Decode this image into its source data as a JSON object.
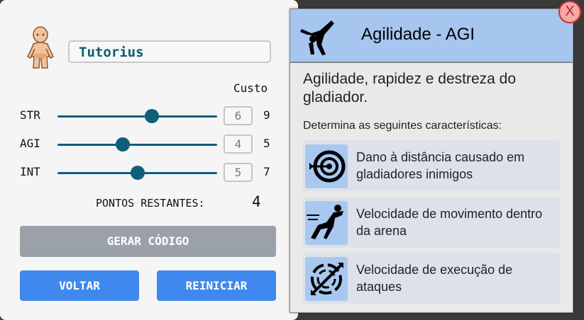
{
  "character": {
    "name": "Tutorius",
    "avatar_icon": "nude-gladiator-sprite"
  },
  "stats": {
    "cost_header": "Custo",
    "rows": [
      {
        "label": "STR",
        "value": "6",
        "cost": "9",
        "slider_level": 0.59
      },
      {
        "label": "AGI",
        "value": "4",
        "cost": "5",
        "slider_level": 0.41
      },
      {
        "label": "INT",
        "value": "5",
        "cost": "7",
        "slider_level": 0.5
      }
    ],
    "remaining_label": "PONTOS RESTANTES:",
    "remaining_value": "4"
  },
  "buttons": {
    "generate": "GERAR CÓDIGO",
    "back": "VOLTAR",
    "reset": "REINICIAR"
  },
  "info_panel": {
    "header_icon": "acrobat-handstand-icon",
    "title": "Agilidade - AGI",
    "description": "Agilidade, rapidez e destreza do gladiador.",
    "subtitle": "Determina as seguintes características:",
    "features": [
      {
        "icon": "target-arrow-icon",
        "text": "Dano à distância causado em gladiadores inimigos"
      },
      {
        "icon": "running-figure-icon",
        "text": "Velocidade de movimento dentro da arena"
      },
      {
        "icon": "whirlwind-swords-icon",
        "text": "Velocidade de execução de ataques"
      }
    ]
  },
  "close_label": "X",
  "colors": {
    "slider": "#0f5f7c",
    "primary_button": "#3f89ee",
    "disabled_button": "#9ba1a8",
    "header_bg": "#a6c5ef",
    "close_bg": "#f4a8a8"
  }
}
